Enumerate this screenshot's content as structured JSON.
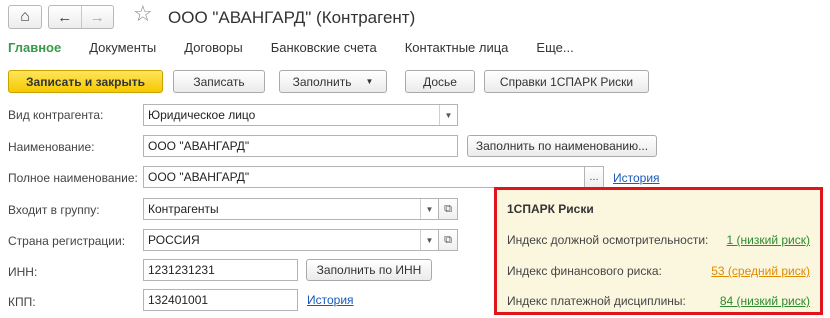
{
  "window": {
    "title": "ООО  \"АВАНГАРД\" (Контрагент)"
  },
  "tabs": [
    "Главное",
    "Документы",
    "Договоры",
    "Банковские счета",
    "Контактные лица",
    "Еще..."
  ],
  "toolbar": {
    "save_close": "Записать и закрыть",
    "save": "Записать",
    "fill": "Заполнить",
    "dossier": "Досье",
    "spark_refs": "Справки 1СПАРК Риски"
  },
  "form": {
    "kind_label": "Вид контрагента:",
    "kind_value": "Юридическое лицо",
    "name_label": "Наименование:",
    "name_value": "ООО  \"АВАНГАРД\"",
    "fill_by_name": "Заполнить по наименованию...",
    "fullname_label": "Полное наименование:",
    "fullname_value": "ООО  \"АВАНГАРД\"",
    "fullname_more": "...",
    "history": "История",
    "group_label": "Входит в группу:",
    "group_value": "Контрагенты",
    "country_label": "Страна регистрации:",
    "country_value": "РОССИЯ",
    "inn_label": "ИНН:",
    "inn_value": "1231231231",
    "fill_by_inn": "Заполнить по ИНН",
    "kpp_label": "КПП:",
    "kpp_value": "132401001",
    "kpp_history": "История"
  },
  "risk": {
    "title": "1СПАРК Риски",
    "items": [
      {
        "label": "Индекс должной осмотрительности:",
        "value": "1 (низкий риск)",
        "color": "#2e8b2e"
      },
      {
        "label": "Индекс финансового риска:",
        "value": "53 (средний риск)",
        "color": "#e08a00"
      },
      {
        "label": "Индекс платежной дисциплины:",
        "value": "84 (низкий риск)",
        "color": "#2e8b2e"
      }
    ],
    "border_color": "#e0151b"
  },
  "icons": {
    "home": "⌂",
    "back": "←",
    "forward": "→",
    "star": "☆",
    "dropdown": "▼",
    "open": "⧉"
  }
}
